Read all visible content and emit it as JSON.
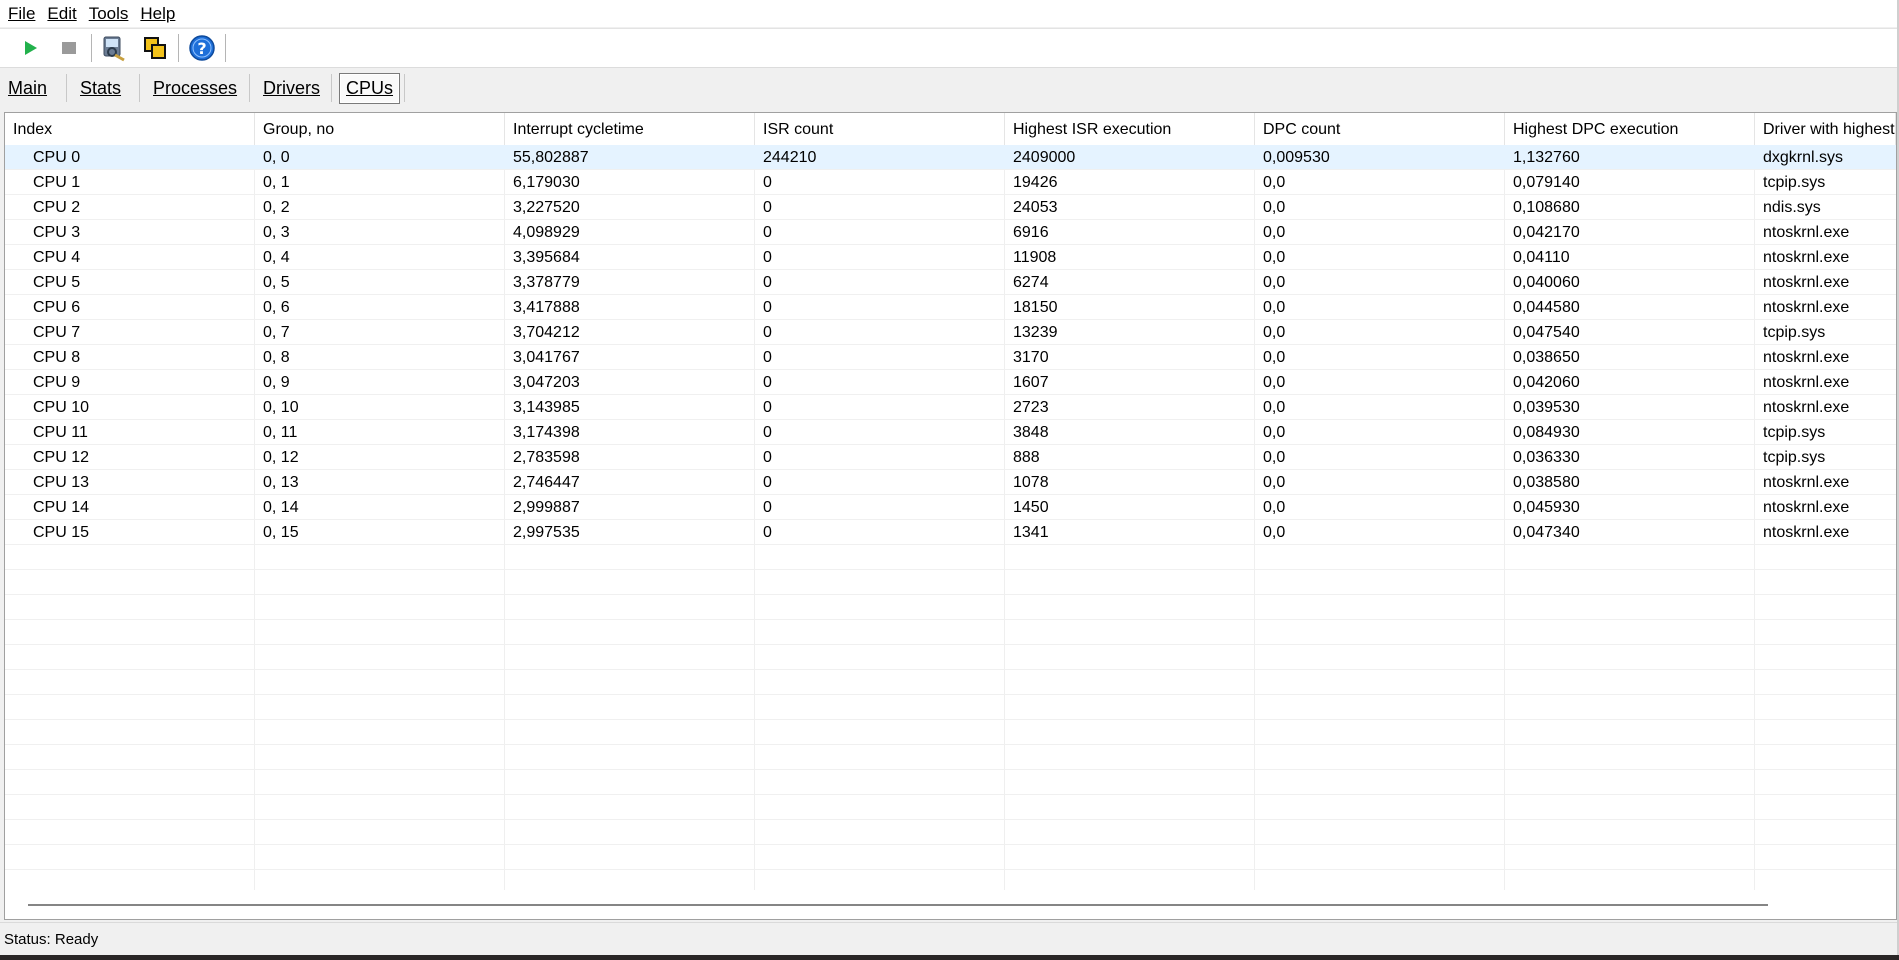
{
  "menu": [
    {
      "label": "File"
    },
    {
      "label": "Edit"
    },
    {
      "label": "Tools"
    },
    {
      "label": "Help"
    }
  ],
  "toolbar": {
    "icons": [
      "play-icon",
      "stop-icon",
      "analyze-icon",
      "windows-icon",
      "help-icon"
    ],
    "colors": {
      "play": "#22b14c",
      "stop": "#9a9a9a",
      "help": "#1e6fd9"
    }
  },
  "tabs": [
    {
      "label": "Main"
    },
    {
      "label": "Stats"
    },
    {
      "label": "Processes"
    },
    {
      "label": "Drivers"
    },
    {
      "label": "CPUs",
      "active": true
    }
  ],
  "table": {
    "columns": [
      "Index",
      "Group, no",
      "Interrupt cycletime",
      "ISR count",
      "Highest ISR execution",
      "DPC count",
      "Highest DPC execution",
      "Driver with highest"
    ],
    "rows": [
      [
        "CPU 0",
        "0, 0",
        "55,802887",
        "244210",
        "2409000",
        "0,009530",
        "1,132760",
        "dxgkrnl.sys"
      ],
      [
        "CPU 1",
        "0, 1",
        "6,179030",
        "0",
        "19426",
        "0,0",
        "0,079140",
        "tcpip.sys"
      ],
      [
        "CPU 2",
        "0, 2",
        "3,227520",
        "0",
        "24053",
        "0,0",
        "0,108680",
        "ndis.sys"
      ],
      [
        "CPU 3",
        "0, 3",
        "4,098929",
        "0",
        "6916",
        "0,0",
        "0,042170",
        "ntoskrnl.exe"
      ],
      [
        "CPU 4",
        "0, 4",
        "3,395684",
        "0",
        "11908",
        "0,0",
        "0,04110",
        "ntoskrnl.exe"
      ],
      [
        "CPU 5",
        "0, 5",
        "3,378779",
        "0",
        "6274",
        "0,0",
        "0,040060",
        "ntoskrnl.exe"
      ],
      [
        "CPU 6",
        "0, 6",
        "3,417888",
        "0",
        "18150",
        "0,0",
        "0,044580",
        "ntoskrnl.exe"
      ],
      [
        "CPU 7",
        "0, 7",
        "3,704212",
        "0",
        "13239",
        "0,0",
        "0,047540",
        "tcpip.sys"
      ],
      [
        "CPU 8",
        "0, 8",
        "3,041767",
        "0",
        "3170",
        "0,0",
        "0,038650",
        "ntoskrnl.exe"
      ],
      [
        "CPU 9",
        "0, 9",
        "3,047203",
        "0",
        "1607",
        "0,0",
        "0,042060",
        "ntoskrnl.exe"
      ],
      [
        "CPU 10",
        "0, 10",
        "3,143985",
        "0",
        "2723",
        "0,0",
        "0,039530",
        "ntoskrnl.exe"
      ],
      [
        "CPU 11",
        "0, 11",
        "3,174398",
        "0",
        "3848",
        "0,0",
        "0,084930",
        "tcpip.sys"
      ],
      [
        "CPU 12",
        "0, 12",
        "2,783598",
        "0",
        "888",
        "0,0",
        "0,036330",
        "tcpip.sys"
      ],
      [
        "CPU 13",
        "0, 13",
        "2,746447",
        "0",
        "1078",
        "0,0",
        "0,038580",
        "ntoskrnl.exe"
      ],
      [
        "CPU 14",
        "0, 14",
        "2,999887",
        "0",
        "1450",
        "0,0",
        "0,045930",
        "ntoskrnl.exe"
      ],
      [
        "CPU 15",
        "0, 15",
        "2,997535",
        "0",
        "1341",
        "0,0",
        "0,047340",
        "ntoskrnl.exe"
      ]
    ],
    "selected_row": 0
  },
  "status": {
    "text": "Status: Ready"
  }
}
